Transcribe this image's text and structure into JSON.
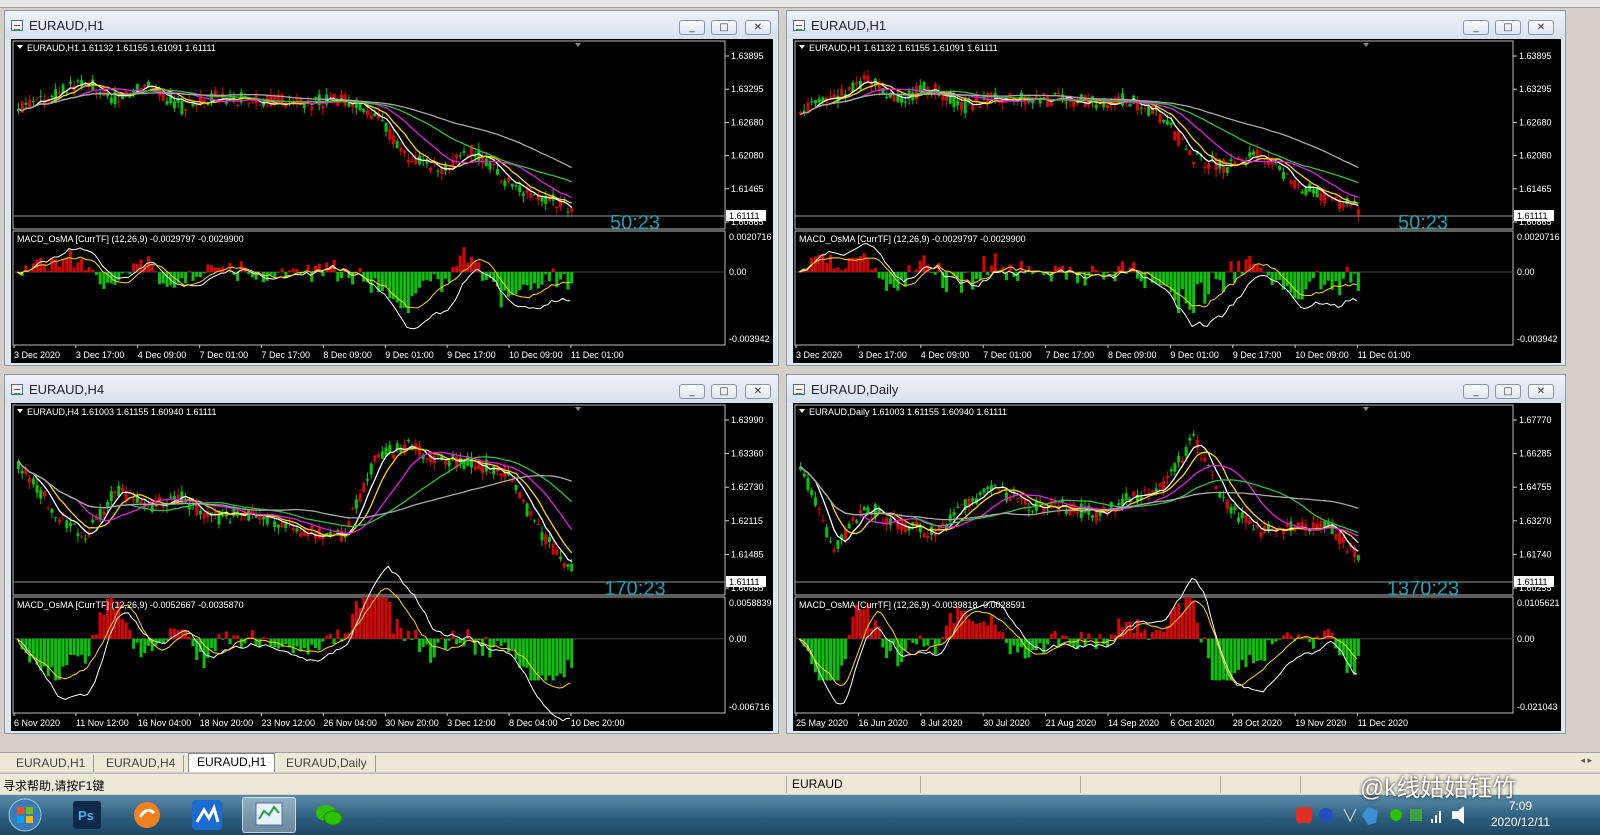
{
  "windows": [
    {
      "id": "w0",
      "title": "EURAUD,H1",
      "info": "EURAUD,H1  1.61132 1.61155 1.61091 1.61111",
      "price_labels": [
        "1.63895",
        "1.63295",
        "1.62680",
        "1.62080",
        "1.61465",
        "1.60865"
      ],
      "current_price": "1.61111",
      "timer": "50:23",
      "macd_info": "MACD_OsMA [CurrTF] (12,26,9) -0.0029797 -0.0029900",
      "macd_labels": [
        "0.0020716",
        "0.00",
        "-0.003942"
      ],
      "time_labels": [
        "3 Dec 2020",
        "3 Dec 17:00",
        "4 Dec 09:00",
        "7 Dec 01:00",
        "7 Dec 17:00",
        "8 Dec 09:00",
        "9 Dec 01:00",
        "9 Dec 17:00",
        "10 Dec 09:00",
        "11 Dec 01:00"
      ]
    },
    {
      "id": "w1",
      "title": "EURAUD,H1",
      "info": "EURAUD,H1  1.61132 1.61155 1.61091 1.61111",
      "price_labels": [
        "1.63895",
        "1.63295",
        "1.62680",
        "1.62080",
        "1.61465",
        "1.60865"
      ],
      "current_price": "1.61111",
      "timer": "50:23",
      "macd_info": "MACD_OsMA [CurrTF] (12,26,9) -0.0029797 -0.0029900",
      "macd_labels": [
        "0.0020716",
        "0.00",
        "-0.003942"
      ],
      "time_labels": [
        "3 Dec 2020",
        "3 Dec 17:00",
        "4 Dec 09:00",
        "7 Dec 01:00",
        "7 Dec 17:00",
        "8 Dec 09:00",
        "9 Dec 01:00",
        "9 Dec 17:00",
        "10 Dec 09:00",
        "11 Dec 01:00"
      ]
    },
    {
      "id": "w2",
      "title": "EURAUD,H4",
      "info": "EURAUD,H4  1.61003 1.61155 1.60940 1.61111",
      "price_labels": [
        "1.63990",
        "1.63360",
        "1.62730",
        "1.62115",
        "1.61485",
        "1.60855"
      ],
      "current_price": "1.61111",
      "timer": "170:23",
      "macd_info": "MACD_OsMA [CurrTF] (12,26,9) -0.0052667 -0.0035870",
      "macd_labels": [
        "0.0058839",
        "0.00",
        "-0.006716"
      ],
      "time_labels": [
        "6 Nov 2020",
        "11 Nov 12:00",
        "16 Nov 04:00",
        "18 Nov 20:00",
        "23 Nov 12:00",
        "26 Nov 04:00",
        "30 Nov 20:00",
        "3 Dec 12:00",
        "8 Dec 04:00",
        "10 Dec 20:00"
      ]
    },
    {
      "id": "w3",
      "title": "EURAUD,Daily",
      "info": "EURAUD,Daily  1.61003 1.61155 1.60940 1.61111",
      "price_labels": [
        "1.67770",
        "1.66285",
        "1.64755",
        "1.63270",
        "1.61740",
        "1.60255"
      ],
      "current_price": "1.61111",
      "timer": "1370:23",
      "macd_info": "MACD_OsMA [CurrTF] (12,26,9) -0.0039818 -0.0028591",
      "macd_labels": [
        "0.0105621",
        "0.00",
        "-0.021043"
      ],
      "time_labels": [
        "25 May 2020",
        "16 Jun 2020",
        "8 Jul 2020",
        "30 Jul 2020",
        "21 Aug 2020",
        "14 Sep 2020",
        "6 Oct 2020",
        "28 Oct 2020",
        "19 Nov 2020",
        "11 Dec 2020"
      ]
    }
  ],
  "tabs": [
    "EURAUD,H1",
    "EURAUD,H4",
    "EURAUD,H1",
    "EURAUD,Daily"
  ],
  "active_tab": 2,
  "status": {
    "help": "寻求帮助,请按F1键",
    "symbol": "EURAUD"
  },
  "clock": {
    "time": "7:09",
    "date": "2020/12/11"
  },
  "watermark": "@k线姑姑钰竹",
  "colors": {
    "bull": "#00c800",
    "bear": "#e00000",
    "ma_fast": "#ffffff",
    "ma_yellow": "#ffd700",
    "ma_magenta": "#e020e0",
    "ma_green": "#30c040",
    "ma_gray": "#a8a8a8",
    "timer": "#20a0b0"
  }
}
